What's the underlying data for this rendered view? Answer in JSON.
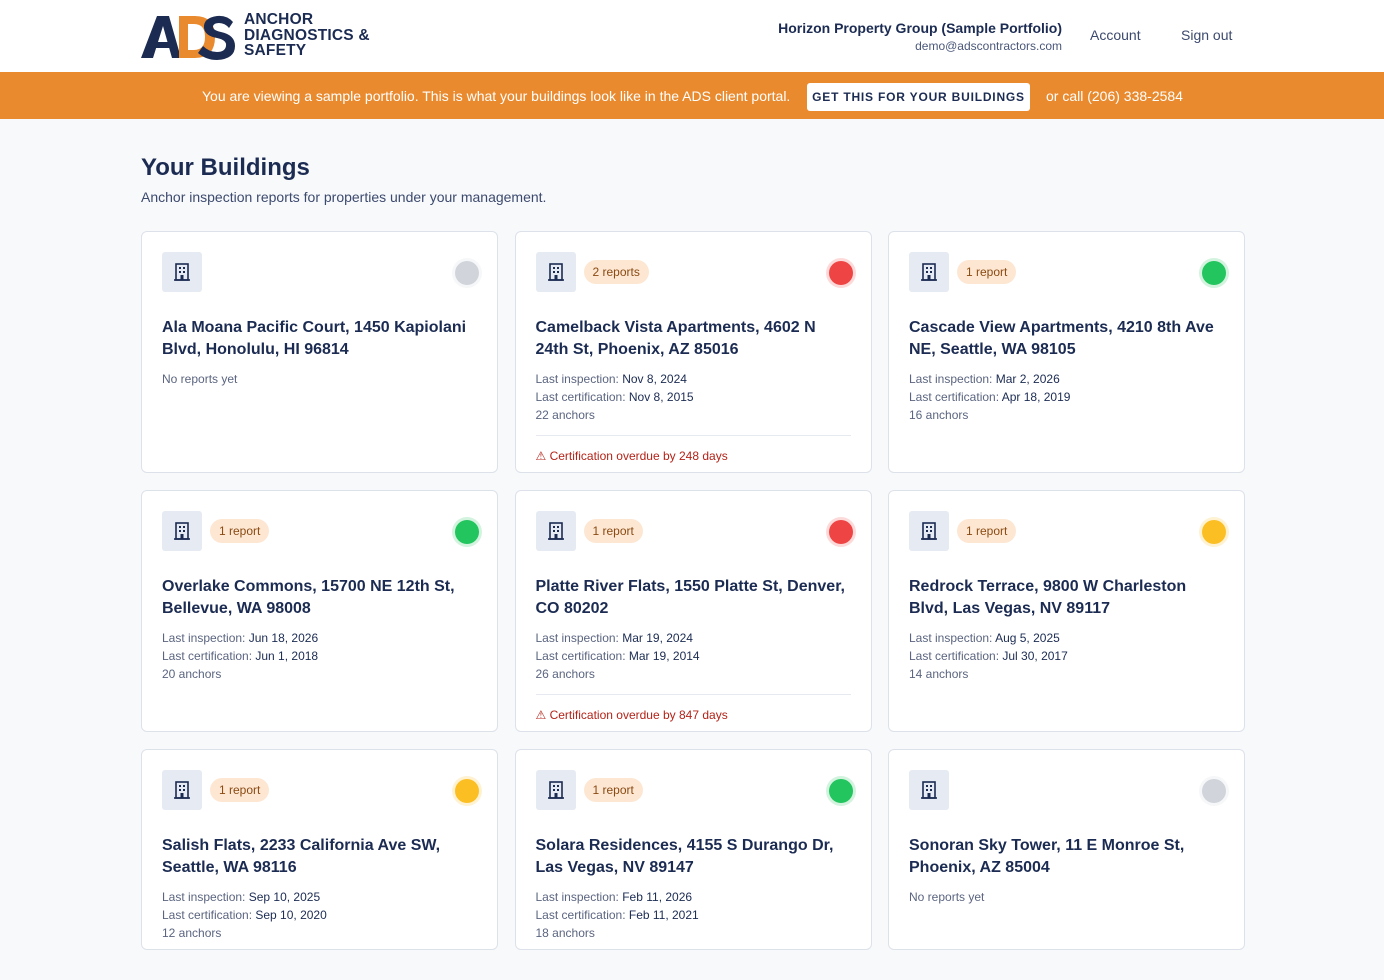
{
  "header": {
    "logo_mark": "ADS",
    "logo_lines": [
      "ANCHOR",
      "DIAGNOSTICS &",
      "SAFETY"
    ],
    "org_name": "Horizon Property Group (Sample Portfolio)",
    "org_email": "demo@adscontractors.com",
    "nav": {
      "account": "Account",
      "sign_out": "Sign out"
    }
  },
  "banner": {
    "text": "You are viewing a sample portfolio. This is what your buildings look like in the ADS client portal.",
    "button": "GET THIS FOR YOUR BUILDINGS",
    "call": "or call (206) 338-2584"
  },
  "page": {
    "title": "Your Buildings",
    "subtitle": "Anchor inspection reports for properties under your management."
  },
  "labels": {
    "last_inspection": "Last inspection: ",
    "last_certification": "Last certification: "
  },
  "colors": {
    "navy": "#1b2b52",
    "orange": "#ea8a2e",
    "status_red": "#ef4444",
    "status_green": "#22c55e",
    "status_yellow": "#fbbf24",
    "status_gray": "#d1d5db"
  },
  "buildings": [
    {
      "title": "Ala Moana Pacific Court, 1450 Kapiolani Blvd, Honolulu, HI 96814",
      "badge": "",
      "status": "gray",
      "no_reports": "No reports yet",
      "last_inspection": "",
      "last_certification": "",
      "anchors": "",
      "warning": ""
    },
    {
      "title": "Camelback Vista Apartments, 4602 N 24th St, Phoenix, AZ 85016",
      "badge": "2 reports",
      "status": "red",
      "no_reports": "",
      "last_inspection": "Nov 8, 2024",
      "last_certification": "Nov 8, 2015",
      "anchors": "22 anchors",
      "warning": "⚠ Certification overdue by 248 days"
    },
    {
      "title": "Cascade View Apartments, 4210 8th Ave NE, Seattle, WA 98105",
      "badge": "1 report",
      "status": "green",
      "no_reports": "",
      "last_inspection": "Mar 2, 2026",
      "last_certification": "Apr 18, 2019",
      "anchors": "16 anchors",
      "warning": ""
    },
    {
      "title": "Overlake Commons, 15700 NE 12th St, Bellevue, WA 98008",
      "badge": "1 report",
      "status": "green",
      "no_reports": "",
      "last_inspection": "Jun 18, 2026",
      "last_certification": "Jun 1, 2018",
      "anchors": "20 anchors",
      "warning": ""
    },
    {
      "title": "Platte River Flats, 1550 Platte St, Denver, CO 80202",
      "badge": "1 report",
      "status": "red",
      "no_reports": "",
      "last_inspection": "Mar 19, 2024",
      "last_certification": "Mar 19, 2014",
      "anchors": "26 anchors",
      "warning": "⚠ Certification overdue by 847 days"
    },
    {
      "title": "Redrock Terrace, 9800 W Charleston Blvd, Las Vegas, NV 89117",
      "badge": "1 report",
      "status": "yellow",
      "no_reports": "",
      "last_inspection": "Aug 5, 2025",
      "last_certification": "Jul 30, 2017",
      "anchors": "14 anchors",
      "warning": ""
    },
    {
      "title": "Salish Flats, 2233 California Ave SW, Seattle, WA 98116",
      "badge": "1 report",
      "status": "yellow",
      "no_reports": "",
      "last_inspection": "Sep 10, 2025",
      "last_certification": "Sep 10, 2020",
      "anchors": "12 anchors",
      "warning": ""
    },
    {
      "title": "Solara Residences, 4155 S Durango Dr, Las Vegas, NV 89147",
      "badge": "1 report",
      "status": "green",
      "no_reports": "",
      "last_inspection": "Feb 11, 2026",
      "last_certification": "Feb 11, 2021",
      "anchors": "18 anchors",
      "warning": ""
    },
    {
      "title": "Sonoran Sky Tower, 11 E Monroe St, Phoenix, AZ 85004",
      "badge": "",
      "status": "gray",
      "no_reports": "No reports yet",
      "last_inspection": "",
      "last_certification": "",
      "anchors": "",
      "warning": ""
    }
  ]
}
